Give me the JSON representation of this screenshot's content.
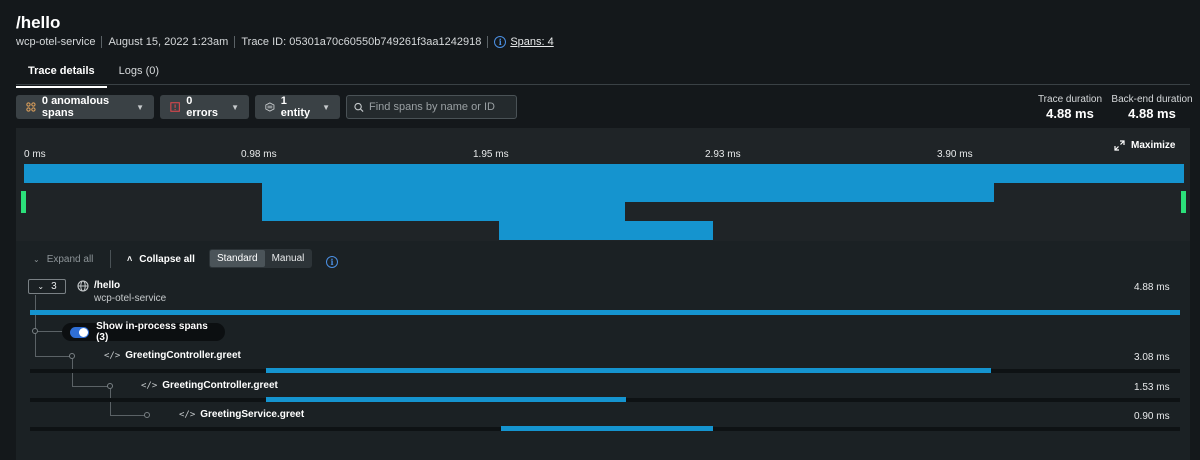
{
  "header": {
    "title": "/hello",
    "service": "wcp-otel-service",
    "date": "August 15, 2022 1:23am",
    "trace_id": "Trace ID: 05301a70c60550b749261f3aa1242918",
    "spans_link": "Spans: 4"
  },
  "tabs": [
    {
      "label": "Trace details",
      "active": true
    },
    {
      "label": "Logs (0)",
      "active": false
    }
  ],
  "filters": {
    "anomalous": "0 anomalous spans",
    "errors": "0 errors",
    "entity": "1 entity",
    "search_placeholder": "Find spans by name or ID"
  },
  "durations": {
    "trace_label": "Trace duration",
    "trace_value": "4.88 ms",
    "backend_label": "Back-end duration",
    "backend_value": "4.88 ms"
  },
  "overview": {
    "ticks": [
      "0 ms",
      "0.98 ms",
      "1.95 ms",
      "2.93 ms",
      "3.90 ms"
    ],
    "maximize_label": "Maximize",
    "total_ms": 4.88,
    "spans": [
      {
        "start_ms": 0,
        "duration_ms": 4.88
      },
      {
        "start_ms": 1.0,
        "duration_ms": 3.08
      },
      {
        "start_ms": 1.0,
        "duration_ms": 1.53
      },
      {
        "start_ms": 2.0,
        "duration_ms": 0.9
      }
    ]
  },
  "toolbar": {
    "expand_all": "Expand all",
    "collapse_all": "Collapse all",
    "standard": "Standard",
    "manual": "Manual"
  },
  "tree": {
    "child_count": "3",
    "inprocess_label": "Show in-process spans (3)",
    "rows": [
      {
        "name": "/hello",
        "service": "wcp-otel-service",
        "duration": "4.88 ms"
      },
      {
        "name": "GreetingController.greet",
        "duration": "3.08 ms"
      },
      {
        "name": "GreetingController.greet",
        "duration": "1.53 ms"
      },
      {
        "name": "GreetingService.greet",
        "duration": "0.90 ms"
      }
    ]
  },
  "colors": {
    "accent": "#1594cf",
    "marker": "#2be07a",
    "error": "#e5484d",
    "warning": "#e2a35c"
  }
}
